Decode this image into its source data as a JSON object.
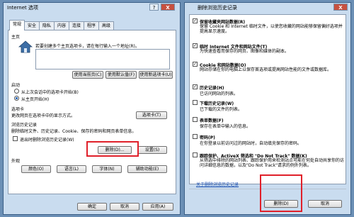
{
  "left_dialog": {
    "title": "Internet 选项",
    "help": "?",
    "close": "X",
    "tabs": [
      "常规",
      "安全",
      "隐私",
      "内容",
      "连接",
      "程序",
      "高级"
    ],
    "home": {
      "section": "主页",
      "desc": "若要创建多个主页选项卡，请在每行输入一个地址(R)。",
      "url": "",
      "use_current": "使用当前页(C)",
      "use_default": "使用默认值(F)",
      "use_blank": "使用新选项卡(U)"
    },
    "startup": {
      "section": "启动",
      "option1": "从上次会话中的选项卡开始(B)",
      "option2": "从主页开始(H)"
    },
    "tabs_section": {
      "section": "选项卡",
      "desc": "更改网页在选项卡中的显示方式。",
      "button": "选项卡(T)"
    },
    "history": {
      "section": "浏览历史记录",
      "desc": "删除临时文件、历史记录、Cookie、保存的密码和网页表单信息。",
      "checkbox": "退出时删除浏览历史记录(W)",
      "delete": "删除(D)...",
      "settings": "设置(S)"
    },
    "appearance": {
      "section": "外观",
      "colors": "颜色(O)",
      "languages": "语言(L)",
      "fonts": "字体(N)",
      "accessibility": "辅助功能(E)"
    },
    "ok": "确定",
    "cancel": "取消",
    "apply": "应用(A)"
  },
  "right_dialog": {
    "title": "删除浏览历史记录",
    "close": "X",
    "items": [
      {
        "label": "保留收藏夹网站数据(R)",
        "checked": true,
        "desc": "保留 Cookie 和 Internet 临时文件，以使您收藏的网站能够保留偏好选项并提高显示速度。"
      },
      {
        "label": "临时 Internet 文件和网站文件(T)",
        "checked": true,
        "desc": "为快速查看而保存的网页、图像和媒体的副本。"
      },
      {
        "label": "Cookie 和网站数据(O)",
        "checked": true,
        "desc": "网站存储在你的电脑上以保存首选项或提高网站性能的文件或数据库。"
      },
      {
        "label": "历史记录(H)",
        "checked": true,
        "desc": "已访问网站的列表。"
      },
      {
        "label": "下载历史记录(W)",
        "checked": false,
        "desc": "已下载的文件的列表。"
      },
      {
        "label": "表单数据(F)",
        "checked": false,
        "desc": "保存在表单中输入的信息。"
      },
      {
        "label": "密码(P)",
        "checked": false,
        "desc": "在你登录以前访问过的网站时，自动填充保存的密码。"
      },
      {
        "label": "跟踪保护、ActiveX 筛选和 \"Do Not Track\" 数据(K)",
        "checked": false,
        "desc": "从筛选中排除的网站列表、跟踪保护用来检测站点可能在何处自动共享你的访问详细信息的数据，以及\"Do Not Track\"请求的例外列表。"
      }
    ],
    "link": "关于删除浏览历史记录",
    "delete": "删除(D)",
    "cancel": "取消"
  }
}
